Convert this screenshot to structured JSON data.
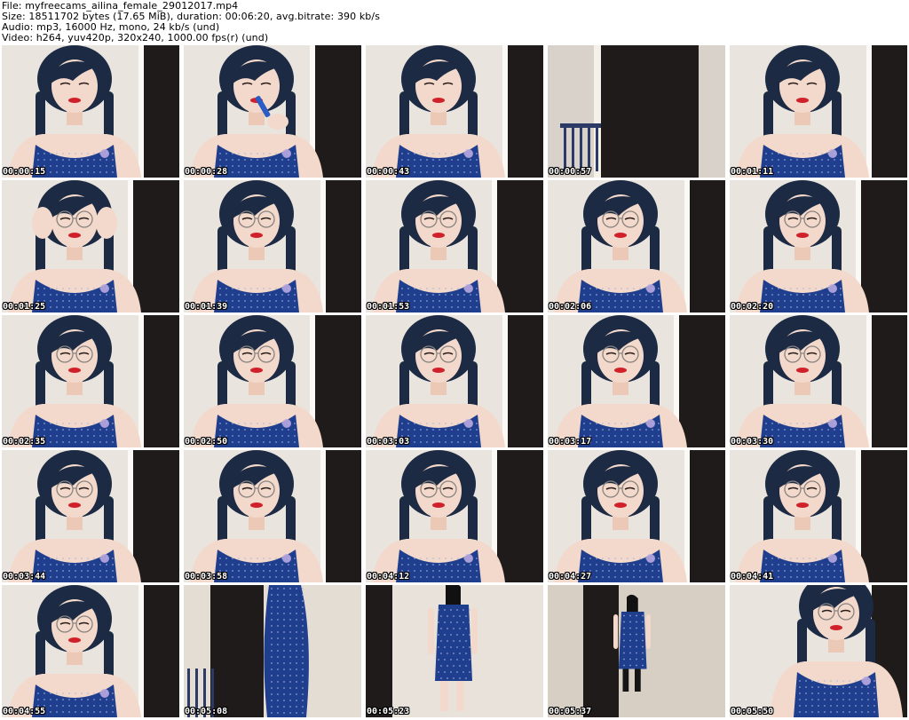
{
  "header": {
    "file_line": "File: myfreecams_ailina_female_29012017.mp4",
    "size_line": "Size: 18511702 bytes (17.65 MiB), duration: 00:06:20, avg.bitrate: 390 kb/s",
    "audio_line": "Audio: mp3, 16000 Hz, mono, 24 kb/s (und)",
    "video_line": "Video: h264, yuv420p, 320x240, 1000.00 fps(r) (und)"
  },
  "thumbnails": [
    {
      "timestamp": "00:00:15",
      "scene": "portrait"
    },
    {
      "timestamp": "00:00:28",
      "scene": "portrait-lipstick"
    },
    {
      "timestamp": "00:00:43",
      "scene": "portrait"
    },
    {
      "timestamp": "00:00:57",
      "scene": "empty-room"
    },
    {
      "timestamp": "00:01:11",
      "scene": "portrait"
    },
    {
      "timestamp": "00:01:25",
      "scene": "portrait-glasses-hands"
    },
    {
      "timestamp": "00:01:39",
      "scene": "portrait-glasses"
    },
    {
      "timestamp": "00:01:53",
      "scene": "portrait-glasses"
    },
    {
      "timestamp": "00:02:06",
      "scene": "portrait-glasses"
    },
    {
      "timestamp": "00:02:20",
      "scene": "portrait-glasses"
    },
    {
      "timestamp": "00:02:35",
      "scene": "portrait-glasses"
    },
    {
      "timestamp": "00:02:50",
      "scene": "portrait-glasses"
    },
    {
      "timestamp": "00:03:03",
      "scene": "portrait-glasses"
    },
    {
      "timestamp": "00:03:17",
      "scene": "portrait-glasses"
    },
    {
      "timestamp": "00:03:30",
      "scene": "portrait-glasses"
    },
    {
      "timestamp": "00:03:44",
      "scene": "portrait-glasses"
    },
    {
      "timestamp": "00:03:58",
      "scene": "portrait-glasses"
    },
    {
      "timestamp": "00:04:12",
      "scene": "portrait-glasses"
    },
    {
      "timestamp": "00:04:27",
      "scene": "portrait-glasses"
    },
    {
      "timestamp": "00:04:41",
      "scene": "portrait-glasses"
    },
    {
      "timestamp": "00:04:55",
      "scene": "portrait-glasses"
    },
    {
      "timestamp": "00:05:08",
      "scene": "dress-closeup"
    },
    {
      "timestamp": "00:05:23",
      "scene": "standing-figure"
    },
    {
      "timestamp": "00:05:37",
      "scene": "standing-figure-far"
    },
    {
      "timestamp": "00:05:50",
      "scene": "portrait-glasses-low"
    }
  ],
  "colors": {
    "wall": "#e9e4de",
    "door": "#1f1b1a",
    "skin": "#f3d9cb",
    "hair": "#1c2a44",
    "dress": "#1f3f8e",
    "lips": "#d0202a",
    "stamp_text": "#ffffff"
  }
}
